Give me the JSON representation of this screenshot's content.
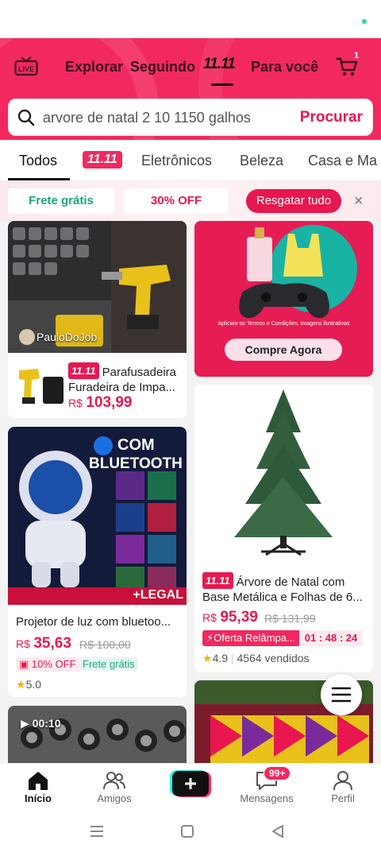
{
  "header": {
    "live_label": "LIVE",
    "tabs": [
      "Explorar",
      "Seguindo",
      "11.11",
      "Para você"
    ],
    "cart_count": "1"
  },
  "search": {
    "value": "arvore de natal 2 10 1150 galhos",
    "button": "Procurar"
  },
  "categories": [
    "Todos",
    "11.11",
    "Eletrônicos",
    "Beleza",
    "Casa e Ma"
  ],
  "promo": {
    "chip1": "Frete grátis",
    "chip2": "30% OFF",
    "redeem": "Resgatar tudo",
    "close": "×"
  },
  "cards": {
    "drill": {
      "creator": "PauloDoJob",
      "badge": "11.11",
      "title": "Parafusadeira Furadeira de Impa...",
      "currency": "R$",
      "price": "103,99"
    },
    "ad": {
      "small_print": "Aplicam-se Termos e Condições. Imagens ilustrativas",
      "button": "Compre Agora"
    },
    "projector": {
      "banner_line1": "COM",
      "banner_line2": "BLUETOOTH",
      "banner_bottom": "+LEGAL",
      "title": "Projetor de luz com bluetoo...",
      "currency": "R$",
      "price": "35,63",
      "old_price": "R$ 100,00",
      "discount": "10% OFF",
      "shipping": "Frete grátis",
      "rating": "5.0"
    },
    "tree": {
      "badge": "11.11",
      "title": "Árvore de Natal com Base Metálica e Folhas de 6...",
      "currency": "R$",
      "price": "95,39",
      "old_price": "R$ 131,99",
      "flash_label": "Oferta Relâmpa...",
      "countdown": "01 : 48 : 24",
      "rating": "4.9",
      "sold": "4564 vendidos"
    },
    "video": {
      "duration": "00:10"
    }
  },
  "bottom_nav": {
    "items": [
      "Início",
      "Amigos",
      "Mensagens",
      "Perfil"
    ],
    "messages_badge": "99+"
  },
  "colors": {
    "brand": "#f2295e",
    "price": "#e8174f",
    "free_shipping": "#1aa77c"
  }
}
